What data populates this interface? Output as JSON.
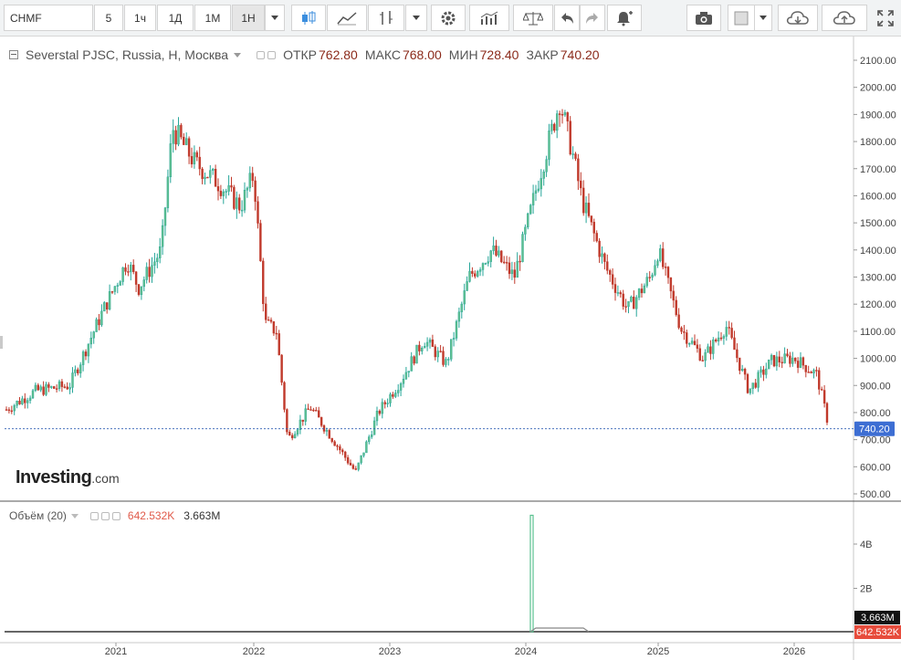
{
  "toolbar": {
    "symbol": "CHMF",
    "intervals": [
      "5",
      "1ч",
      "1Д",
      "1М",
      "1Н"
    ],
    "active_interval": "1Н",
    "icons": [
      "dropdown-arrow",
      "candles-icon",
      "line-chart-icon",
      "bar-chart-icon",
      "dropdown-arrow",
      "gear-icon",
      "indicators-icon",
      "compare-icon",
      "undo-icon",
      "redo-icon",
      "alert-icon",
      "camera-icon",
      "color-icon",
      "dropdown-arrow",
      "cloud-download-icon",
      "cloud-upload-icon",
      "fullscreen-icon"
    ]
  },
  "header": {
    "title": "Severstal PJSC, Russia, H, Москва",
    "open_label": "ОТКР",
    "open": "762.80",
    "high_label": "МАКС",
    "high": "768.00",
    "low_label": "МИН",
    "low": "728.40",
    "close_label": "ЗАКР",
    "close": "740.20"
  },
  "volume_header": {
    "label": "Объём (20)",
    "value1": "642.532K",
    "value2": "3.663M"
  },
  "logo": {
    "main": "Investing",
    "suffix": ".com"
  },
  "colors": {
    "up": "#26a69a",
    "up_fill": "#5fbf8e",
    "down": "#c0392b",
    "grid": "#e6e6e6",
    "badge": "#3d6ed3",
    "vol_badge": "#e74c3c",
    "vol_line": "#666666",
    "vol_spike": "#59c08f"
  },
  "chart_data": [
    {
      "type": "candlestick",
      "title": "Severstal PJSC, Russia, H, Москва",
      "x_axis_labels": [
        "2021",
        "2022",
        "2023",
        "2024",
        "2025",
        "2026"
      ],
      "y_tick_labels": [
        "500.00",
        "600.00",
        "700.00",
        "800.00",
        "900.00",
        "1000.00",
        "1100.00",
        "1200.00",
        "1300.00",
        "1400.00",
        "1500.00",
        "1600.00",
        "1700.00",
        "1800.00",
        "1900.00",
        "2000.00",
        "2100.00"
      ],
      "ylim": [
        460,
        2110
      ],
      "last_price": 740.2,
      "last_price_label": "740.20",
      "grid": false,
      "approx_close_path": [
        [
          "2020-03",
          800
        ],
        [
          "2020-06",
          880
        ],
        [
          "2020-09",
          900
        ],
        [
          "2020-12",
          1180
        ],
        [
          "2021-02",
          1360
        ],
        [
          "2021-03",
          1260
        ],
        [
          "2021-05",
          1400
        ],
        [
          "2021-06",
          1850
        ],
        [
          "2021-08",
          1720
        ],
        [
          "2021-10",
          1650
        ],
        [
          "2021-12",
          1560
        ],
        [
          "2022-01",
          1680
        ],
        [
          "2022-02",
          1130
        ],
        [
          "2022-03",
          1100
        ],
        [
          "2022-04",
          700
        ],
        [
          "2022-06",
          820
        ],
        [
          "2022-08",
          700
        ],
        [
          "2022-10",
          580
        ],
        [
          "2022-12",
          800
        ],
        [
          "2023-02",
          920
        ],
        [
          "2023-04",
          1070
        ],
        [
          "2023-06",
          980
        ],
        [
          "2023-08",
          1300
        ],
        [
          "2023-10",
          1400
        ],
        [
          "2023-12",
          1300
        ],
        [
          "2024-02",
          1640
        ],
        [
          "2024-04",
          1950
        ],
        [
          "2024-05",
          1780
        ],
        [
          "2024-06",
          1580
        ],
        [
          "2024-08",
          1340
        ],
        [
          "2024-10",
          1180
        ],
        [
          "2024-12",
          1300
        ],
        [
          "2025-01",
          1400
        ],
        [
          "2025-03",
          1110
        ],
        [
          "2025-05",
          1000
        ],
        [
          "2025-07",
          1120
        ],
        [
          "2025-09",
          880
        ],
        [
          "2025-11",
          990
        ],
        [
          "2026-01",
          1000
        ],
        [
          "2026-03",
          940
        ],
        [
          "2026-04",
          760
        ]
      ]
    },
    {
      "type": "line",
      "title": "Объём (20)",
      "y_tick_labels": [
        "2B",
        "4B"
      ],
      "ylim": [
        0,
        5600000000
      ],
      "series": [
        {
          "name": "Объём",
          "x": [
            "2020-03",
            "2024-01",
            "2024-01",
            "2024-02",
            "2026-04"
          ],
          "values": [
            0,
            0,
            5300000000,
            0,
            0
          ]
        }
      ],
      "last_value_labels": [
        "3.663M",
        "642.532K"
      ]
    }
  ]
}
